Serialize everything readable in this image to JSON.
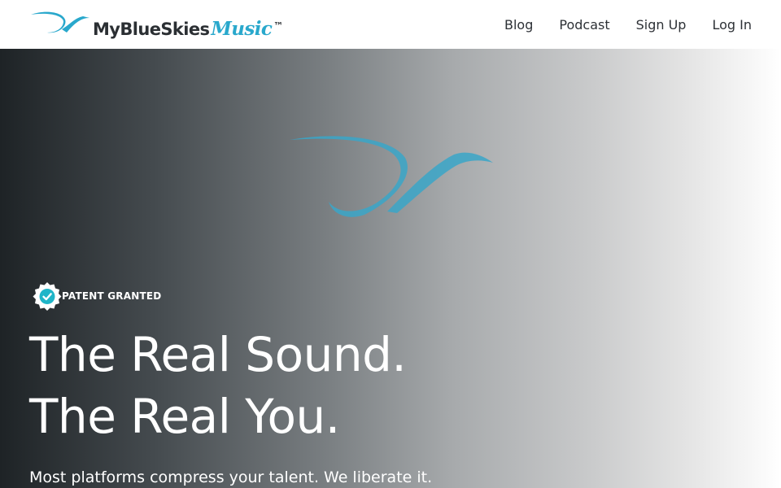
{
  "brand": {
    "name_main": "MyBlueSkies",
    "name_accent": "Music",
    "trademark": "™"
  },
  "nav": {
    "items": [
      {
        "label": "Blog"
      },
      {
        "label": "Podcast"
      },
      {
        "label": "Sign Up"
      },
      {
        "label": "Log In"
      }
    ]
  },
  "hero": {
    "badge_label": "PATENT GRANTED",
    "headline_line1": "The Real Sound.",
    "headline_line2": "The Real You.",
    "subline": "Most platforms compress your talent. We liberate it."
  },
  "colors": {
    "accent": "#29a8cc",
    "seal_check": "#1fb5c8",
    "nav_text": "#2d3136"
  },
  "icons": {
    "logo": "bird-swoosh-icon",
    "hero_mark": "bird-swoosh-icon",
    "badge": "verified-seal-icon"
  }
}
